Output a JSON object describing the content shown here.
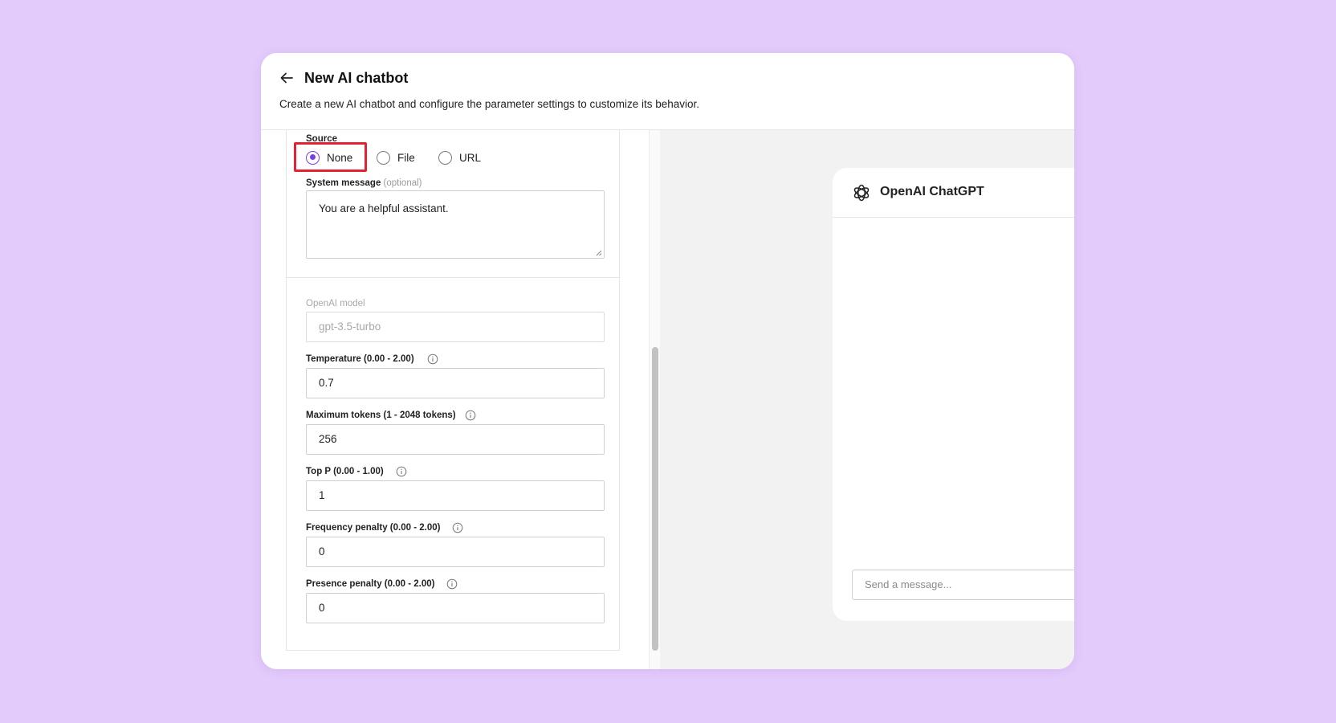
{
  "header": {
    "title": "New AI chatbot",
    "subtitle": "Create a new AI chatbot and configure the parameter settings to customize its behavior."
  },
  "source": {
    "label": "Source",
    "options": [
      {
        "label": "None",
        "checked": true
      },
      {
        "label": "File",
        "checked": false
      },
      {
        "label": "URL",
        "checked": false
      }
    ]
  },
  "system_message": {
    "label": "System message",
    "optional": "(optional)",
    "value": "You are a helpful assistant."
  },
  "model": {
    "label": "OpenAI model",
    "value": "gpt-3.5-turbo"
  },
  "temperature": {
    "label": "Temperature (0.00 - 2.00)",
    "value": "0.7"
  },
  "max_tokens": {
    "label": "Maximum tokens (1 - 2048 tokens)",
    "value": "256"
  },
  "top_p": {
    "label": "Top P (0.00 - 1.00)",
    "value": "1"
  },
  "frequency_penalty": {
    "label": "Frequency penalty (0.00 - 2.00)",
    "value": "0"
  },
  "presence_penalty": {
    "label": "Presence penalty (0.00 - 2.00)",
    "value": "0"
  },
  "preview": {
    "title": "OpenAI ChatGPT",
    "input_placeholder": "Send a message..."
  },
  "colors": {
    "background": "#e3cbfb",
    "accent": "#7b3fe4",
    "highlight": "#e52232"
  },
  "icons": {
    "back": "arrow-left-icon",
    "info": "info-circle-icon",
    "brand": "openai-logo-icon"
  }
}
